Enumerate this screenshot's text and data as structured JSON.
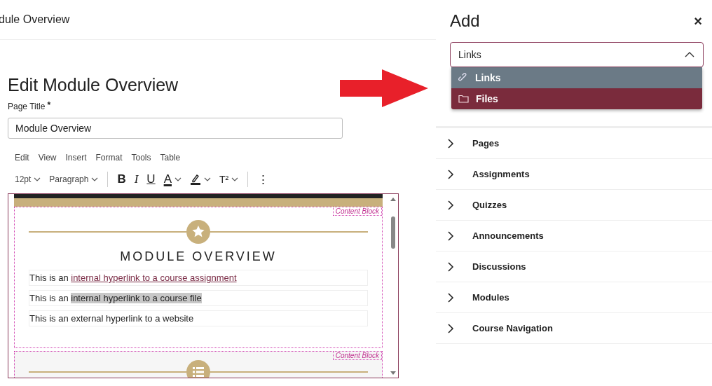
{
  "header": {
    "title": "dule Overview"
  },
  "page_heading": "Edit Module Overview",
  "page_title_field": {
    "label": "Page Title",
    "required_mark": "*",
    "value": "Module Overview"
  },
  "menu_bar": [
    "Edit",
    "View",
    "Insert",
    "Format",
    "Tools",
    "Table"
  ],
  "toolbar": [
    {
      "kind": "dropdown",
      "label": "12pt"
    },
    {
      "kind": "dropdown",
      "label": "Paragraph"
    },
    {
      "kind": "divider"
    },
    {
      "kind": "bold",
      "label": "B"
    },
    {
      "kind": "italic",
      "label": "I"
    },
    {
      "kind": "underline",
      "label": "U"
    },
    {
      "kind": "color",
      "label": "A"
    },
    {
      "kind": "highlight"
    },
    {
      "kind": "glyph-caret",
      "label": "T²"
    },
    {
      "kind": "divider"
    },
    {
      "kind": "more",
      "label": "⋮"
    }
  ],
  "editor": {
    "blocks": [
      {
        "tag": "Content Block",
        "kind": "star",
        "heading": "MODULE OVERVIEW",
        "paragraphs": [
          [
            {
              "kind": "plain",
              "text": "This is an "
            },
            {
              "kind": "link",
              "text": "internal hyperlink to a course assignment"
            }
          ],
          [
            {
              "kind": "plain",
              "text": "This is an "
            },
            {
              "kind": "selected",
              "text": "internal hyperlink to a course file"
            }
          ],
          [
            {
              "kind": "plain",
              "text": "This is an external hyperlink to a website"
            }
          ]
        ]
      },
      {
        "tag": "Content Block",
        "kind": "list"
      }
    ]
  },
  "panel": {
    "title": "Add",
    "close": "×",
    "select": {
      "value": "Links",
      "expanded": true,
      "options": [
        {
          "label": "Links",
          "kind": "link",
          "selected": true,
          "hovered": false
        },
        {
          "label": "Files",
          "kind": "folder",
          "selected": false,
          "hovered": true
        }
      ]
    },
    "sections": [
      {
        "label": "Pages",
        "expanded": false
      },
      {
        "label": "Assignments",
        "expanded": false
      },
      {
        "label": "Quizzes",
        "expanded": false
      },
      {
        "label": "Announcements",
        "expanded": false
      },
      {
        "label": "Discussions",
        "expanded": false
      },
      {
        "label": "Modules",
        "expanded": false
      },
      {
        "label": "Course Navigation",
        "expanded": false
      }
    ]
  }
}
